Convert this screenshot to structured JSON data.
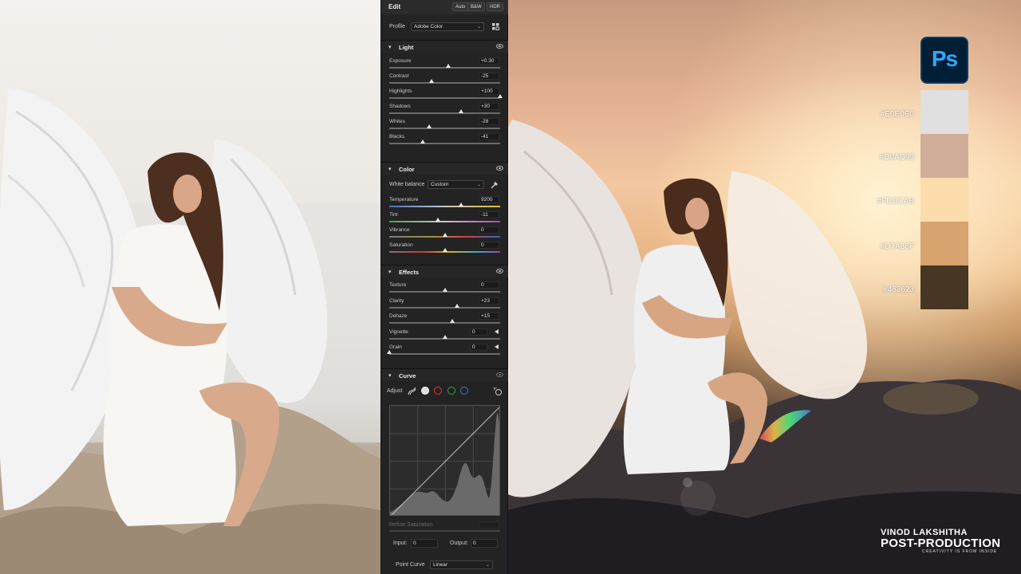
{
  "panel": {
    "title": "Edit",
    "chips": [
      "Auto",
      "B&W",
      "HDR"
    ],
    "profile": {
      "label": "Profile",
      "value": "Adobe Color"
    },
    "light": {
      "title": "Light",
      "sliders": [
        {
          "label": "Exposure",
          "value": "+0.30",
          "pos": 0.53
        },
        {
          "label": "Contrast",
          "value": "-25",
          "pos": 0.38
        },
        {
          "label": "Highlights",
          "value": "+100",
          "pos": 1.0
        },
        {
          "label": "Shadows",
          "value": "+30",
          "pos": 0.65
        },
        {
          "label": "Whites",
          "value": "-28",
          "pos": 0.36
        },
        {
          "label": "Blacks",
          "value": "-41",
          "pos": 0.3
        }
      ]
    },
    "color": {
      "title": "Color",
      "white_balance": {
        "label": "White balance",
        "value": "Custom"
      },
      "sliders": [
        {
          "label": "Temperature",
          "value": "9200",
          "pos": 0.65
        },
        {
          "label": "Tint",
          "value": "-11",
          "pos": 0.44
        },
        {
          "label": "Vibrance",
          "value": "0",
          "pos": 0.5
        },
        {
          "label": "Saturation",
          "value": "0",
          "pos": 0.5
        }
      ]
    },
    "effects": {
      "title": "Effects",
      "sliders": [
        {
          "label": "Texture",
          "value": "0",
          "pos": 0.5
        },
        {
          "label": "Clarity",
          "value": "+23",
          "pos": 0.61
        },
        {
          "label": "Dehaze",
          "value": "+15",
          "pos": 0.57
        },
        {
          "label": "Vignette",
          "value": "0",
          "pos": 0.5
        },
        {
          "label": "Grain",
          "value": "0",
          "pos": 0.0
        }
      ]
    },
    "curve": {
      "title": "Curve",
      "adjust_label": "Adjust",
      "refine_label": "Refine Saturation",
      "input_label": "Input:",
      "input_value": "0",
      "output_label": "Output:",
      "output_value": "0",
      "point_curve_label": "Point Curve",
      "point_curve_value": "Linear"
    }
  },
  "palette": [
    {
      "hex": "#E0E0E0",
      "color": "#E0E0E0"
    },
    {
      "hex": "#D0AD99",
      "color": "#D0AD99"
    },
    {
      "hex": "#FDDCAB",
      "color": "#FDDCAB"
    },
    {
      "hex": "#D7A36F",
      "color": "#D7A36F"
    },
    {
      "hex": "#463623",
      "color": "#463623"
    }
  ],
  "logo": {
    "text": "Ps"
  },
  "brand": {
    "line1": "VINOD LAKSHITHA",
    "line2": "POST-PRODUCTION",
    "line3": "CREATIVITY IS FROM INSIDE"
  }
}
